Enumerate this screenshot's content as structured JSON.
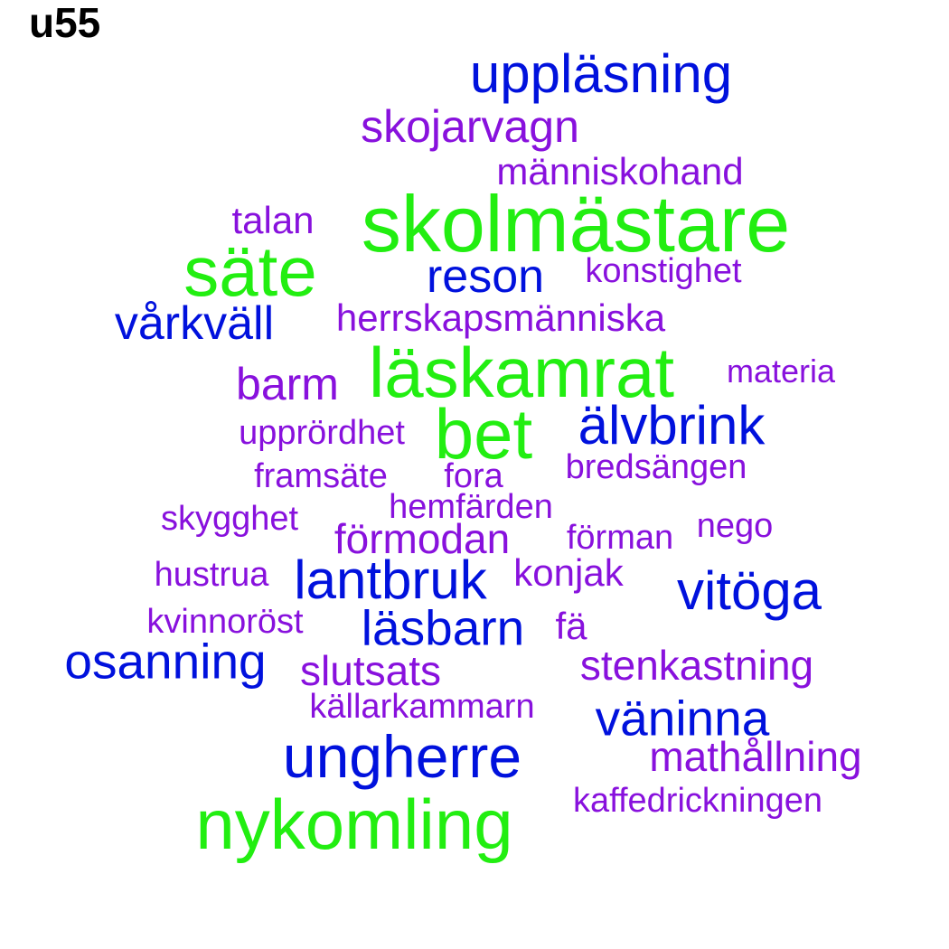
{
  "title": "u55",
  "colors": {
    "green": "#22ee11",
    "blue": "#0011dd",
    "purple": "#8811dd"
  },
  "words": [
    {
      "text": "uppläsning",
      "color": "blue"
    },
    {
      "text": "skojarvagn",
      "color": "purple"
    },
    {
      "text": "människohand",
      "color": "purple"
    },
    {
      "text": "talan",
      "color": "purple"
    },
    {
      "text": "skolmästare",
      "color": "green"
    },
    {
      "text": "säte",
      "color": "green"
    },
    {
      "text": "reson",
      "color": "blue"
    },
    {
      "text": "konstighet",
      "color": "purple"
    },
    {
      "text": "vårkväll",
      "color": "blue"
    },
    {
      "text": "herrskapsmänniska",
      "color": "purple"
    },
    {
      "text": "läskamrat",
      "color": "green"
    },
    {
      "text": "materia",
      "color": "purple"
    },
    {
      "text": "barm",
      "color": "purple"
    },
    {
      "text": "bet",
      "color": "green"
    },
    {
      "text": "älvbrink",
      "color": "blue"
    },
    {
      "text": "upprördhet",
      "color": "purple"
    },
    {
      "text": "framsäte",
      "color": "purple"
    },
    {
      "text": "fora",
      "color": "purple"
    },
    {
      "text": "bredsängen",
      "color": "purple"
    },
    {
      "text": "hemfärden",
      "color": "purple"
    },
    {
      "text": "skygghet",
      "color": "purple"
    },
    {
      "text": "förmodan",
      "color": "purple"
    },
    {
      "text": "förman",
      "color": "purple"
    },
    {
      "text": "nego",
      "color": "purple"
    },
    {
      "text": "hustrua",
      "color": "purple"
    },
    {
      "text": "lantbruk",
      "color": "blue"
    },
    {
      "text": "konjak",
      "color": "purple"
    },
    {
      "text": "vitöga",
      "color": "blue"
    },
    {
      "text": "kvinnoröst",
      "color": "purple"
    },
    {
      "text": "läsbarn",
      "color": "blue"
    },
    {
      "text": "fä",
      "color": "purple"
    },
    {
      "text": "osanning",
      "color": "blue"
    },
    {
      "text": "slutsats",
      "color": "purple"
    },
    {
      "text": "stenkastning",
      "color": "purple"
    },
    {
      "text": "källarkammarn",
      "color": "purple"
    },
    {
      "text": "väninna",
      "color": "blue"
    },
    {
      "text": "ungherre",
      "color": "blue"
    },
    {
      "text": "mathållning",
      "color": "purple"
    },
    {
      "text": "kaffedrickningen",
      "color": "purple"
    },
    {
      "text": "nykomling",
      "color": "green"
    }
  ]
}
